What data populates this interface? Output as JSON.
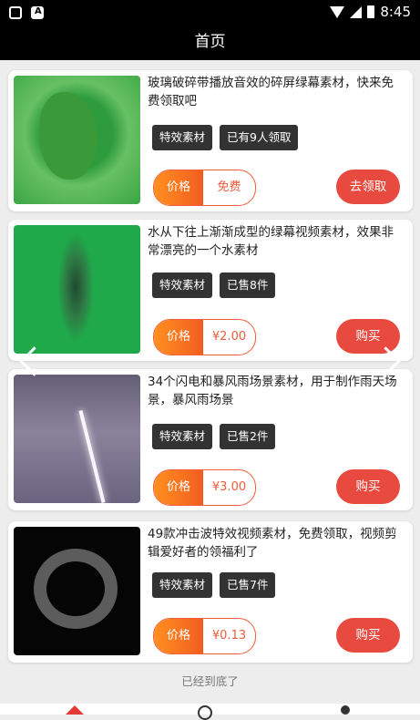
{
  "status_bar": {
    "time": "8:45"
  },
  "header": {
    "title": "首页"
  },
  "products": [
    {
      "title": "玻璃破碎带播放音效的碎屏绿幕素材，快来免费领取吧",
      "tags": [
        "特效素材",
        "已有9人领取"
      ],
      "price_label": "价格",
      "price": "免费",
      "action": "去领取",
      "thumb_icon": "green-broken-glass"
    },
    {
      "title": "水从下往上渐渐成型的绿幕视频素材，效果非常漂亮的一个水素材",
      "tags": [
        "特效素材",
        "已售8件"
      ],
      "price_label": "价格",
      "price": "¥2.00",
      "action": "购买",
      "thumb_icon": "green-water-splash"
    },
    {
      "title": "34个闪电和暴风雨场景素材，用于制作雨天场景，暴风雨场景",
      "tags": [
        "特效素材",
        "已售2件"
      ],
      "price_label": "价格",
      "price": "¥3.00",
      "action": "购买",
      "thumb_icon": "lightning-storm"
    },
    {
      "title": "49款冲击波特效视频素材，免费领取，视频剪辑爱好者的领福利了",
      "tags": [
        "特效素材",
        "已售7件"
      ],
      "price_label": "价格",
      "price": "¥0.13",
      "action": "购买",
      "thumb_icon": "shockwave"
    }
  ],
  "footer": {
    "end_text": "已经到底了"
  },
  "theme": {
    "accent": "#e94a3f",
    "header_bg": "#000000"
  }
}
